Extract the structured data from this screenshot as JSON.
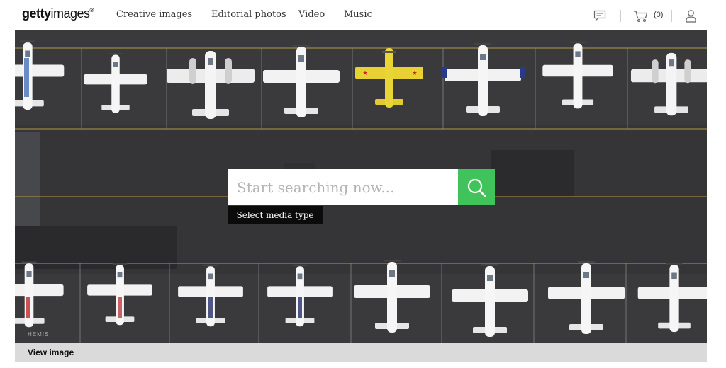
{
  "header": {
    "logo": {
      "bold": "getty",
      "regular": "images",
      "mark": "®"
    },
    "nav": [
      {
        "label": "Creative images"
      },
      {
        "label": "Editorial photos"
      },
      {
        "label": "Video"
      },
      {
        "label": "Music"
      }
    ],
    "icons": {
      "messages": "chat-icon",
      "cart": "cart-icon",
      "account": "user-icon"
    },
    "cart_count": "(0)"
  },
  "hero": {
    "search": {
      "placeholder": "Start searching now...",
      "value": ""
    },
    "media_type_label": "Select media type",
    "view_image_label": "View image",
    "credit": "HEMIS",
    "colors": {
      "search_button": "#3fc35a",
      "tarmac": "#3a3a3c",
      "stripe": "#b39a4a"
    }
  }
}
